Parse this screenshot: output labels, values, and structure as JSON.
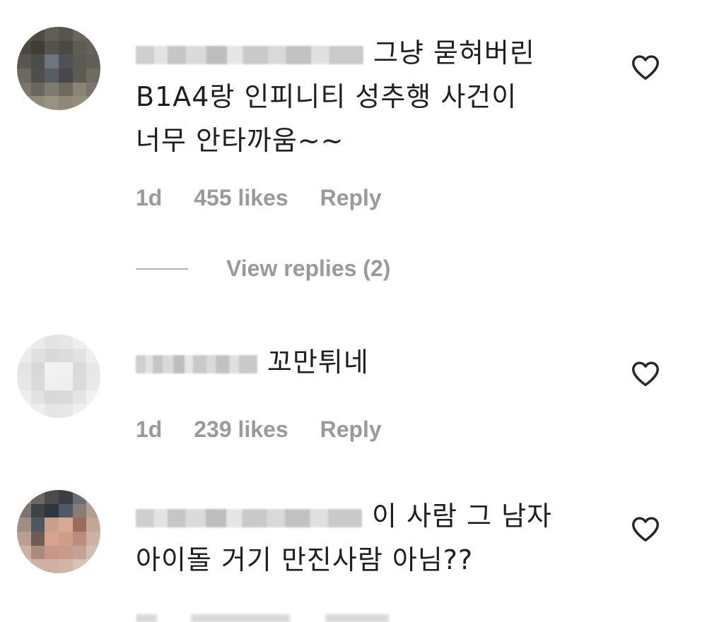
{
  "comments": [
    {
      "text_lines": [
        "그냥 묻혀버린",
        "B1A4랑 인피니티 성추행 사건이",
        "너무 안타까움~~"
      ],
      "time": "1d",
      "likes": "455 likes",
      "reply": "Reply",
      "view_replies": "View replies (2)"
    },
    {
      "text_lines": [
        "꼬만튀네"
      ],
      "time": "1d",
      "likes": "239 likes",
      "reply": "Reply"
    },
    {
      "text_lines": [
        "이 사람 그 남자",
        "아이돌 거기 만진사람 아님??"
      ]
    }
  ],
  "icons": {
    "like": "heart-outline-icon"
  },
  "colors": {
    "meta_text": "#9a9a9a",
    "body_text": "#1f1f1f"
  }
}
